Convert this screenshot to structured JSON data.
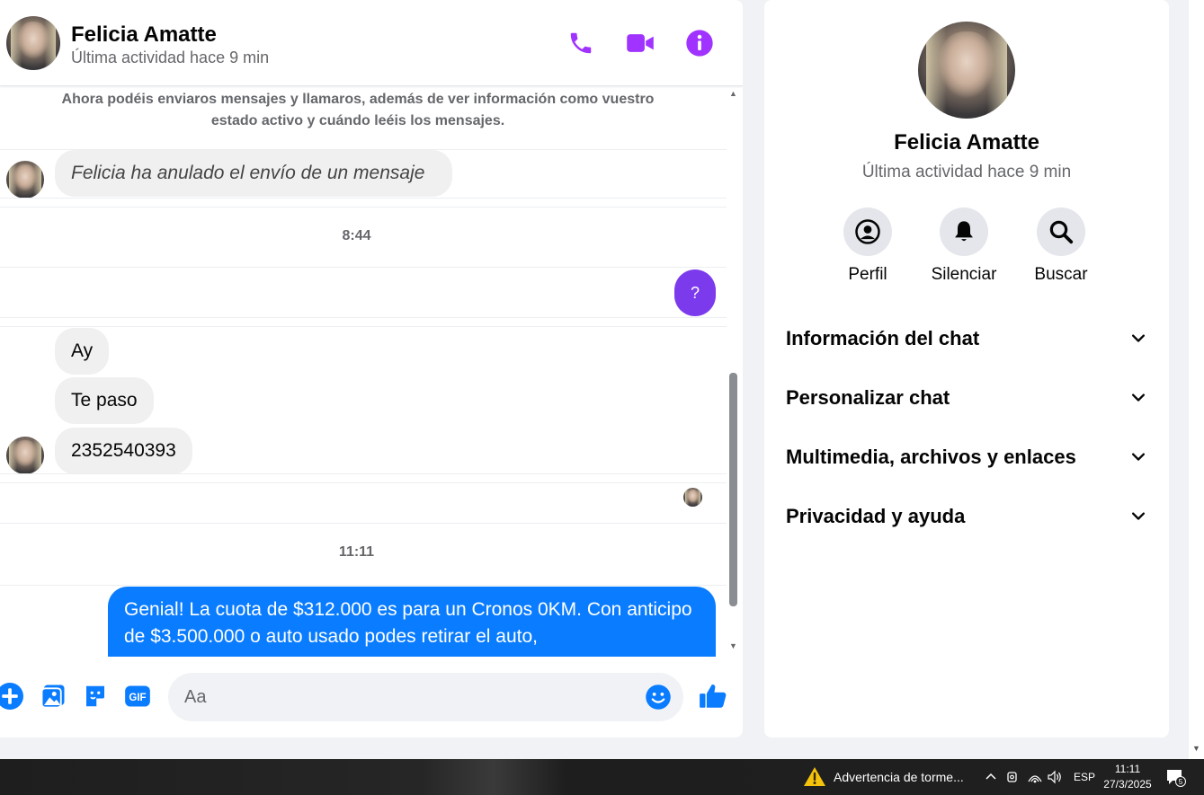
{
  "header": {
    "name": "Felicia Amatte",
    "status": "Última actividad hace 9 min",
    "icons": [
      "phone-icon",
      "video-camera-icon",
      "info-icon"
    ]
  },
  "messages": {
    "system_note": "Ahora podéis enviaros mensajes y llamaros, además de ver información como vuestro estado activo y cuándo leéis los mensajes.",
    "unsent_note": "Felicia ha anulado el envío de un mensaje",
    "time_1": "8:44",
    "outgoing_question": "?",
    "incoming": [
      "Ay",
      "Te paso",
      "2352540393"
    ],
    "time_2": "11:11",
    "outgoing_long": "Genial! La cuota de $312.000 es para un Cronos 0KM. Con anticipo de $3.500.000 o auto usado podes retirar el auto,"
  },
  "composer": {
    "placeholder": "Aa",
    "gif_label": "GIF"
  },
  "info_panel": {
    "name": "Felicia Amatte",
    "status": "Última actividad hace 9 min",
    "actions": [
      {
        "label": "Perfil",
        "icon": "profile-icon"
      },
      {
        "label": "Silenciar",
        "icon": "bell-icon"
      },
      {
        "label": "Buscar",
        "icon": "search-icon"
      }
    ],
    "sections": [
      "Información del chat",
      "Personalizar chat",
      "Multimedia, archivos y enlaces",
      "Privacidad y ayuda"
    ]
  },
  "taskbar": {
    "weather": "Advertencia de torme...",
    "language": "ESP",
    "time": "11:11",
    "date": "27/3/2025",
    "notifications": "5"
  },
  "colors": {
    "accent_purple": "#a033ff",
    "messenger_blue": "#0a7cff",
    "question_bubble": "#7c3aed"
  }
}
